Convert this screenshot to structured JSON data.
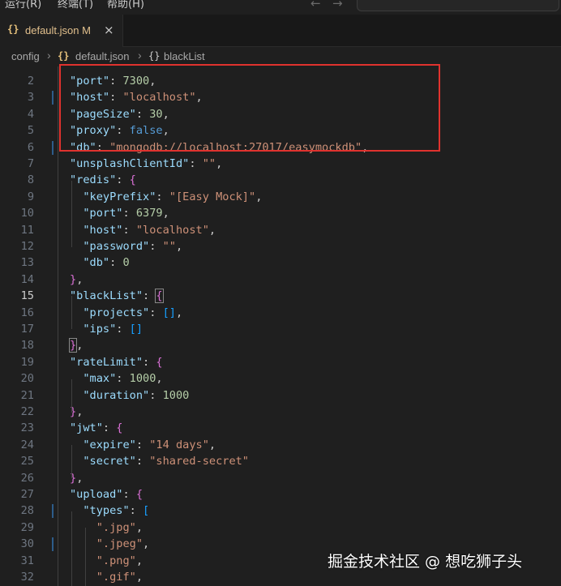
{
  "menubar": {
    "items": [
      "运行(R)",
      "终端(T)",
      "帮助(H)"
    ]
  },
  "tab": {
    "filename": "default.json",
    "modified": "M"
  },
  "breadcrumb": {
    "items": [
      "config",
      "default.json",
      "blackList"
    ]
  },
  "editor": {
    "lines": [
      {
        "n": "2",
        "html": "<span class='k'>\"port\"</span>: <span class='n'>7300</span>,"
      },
      {
        "n": "3",
        "html": "<span class='k'>\"host\"</span>: <span class='s'>\"localhost\"</span>,"
      },
      {
        "n": "4",
        "html": "<span class='k'>\"pageSize\"</span>: <span class='n'>30</span>,"
      },
      {
        "n": "5",
        "html": "<span class='k'>\"proxy\"</span>: <span class='b'>false</span>,"
      },
      {
        "n": "6",
        "html": "<span class='k'>\"db\"</span>: <span class='s'>\"mongodb://localhost:27017/easymockdb\"</span>,"
      },
      {
        "n": "7",
        "html": "<span class='k'>\"unsplashClientId\"</span>: <span class='s'>\"\"</span>,"
      },
      {
        "n": "8",
        "html": "<span class='k'>\"redis\"</span>: <span class='br1'>{</span>"
      },
      {
        "n": "9",
        "html": "  <span class='k'>\"keyPrefix\"</span>: <span class='s'>\"[Easy Mock]\"</span>,"
      },
      {
        "n": "10",
        "html": "  <span class='k'>\"port\"</span>: <span class='n'>6379</span>,"
      },
      {
        "n": "11",
        "html": "  <span class='k'>\"host\"</span>: <span class='s'>\"localhost\"</span>,"
      },
      {
        "n": "12",
        "html": "  <span class='k'>\"password\"</span>: <span class='s'>\"\"</span>,"
      },
      {
        "n": "13",
        "html": "  <span class='k'>\"db\"</span>: <span class='n'>0</span>"
      },
      {
        "n": "14",
        "html": "<span class='br1'>}</span>,"
      },
      {
        "n": "15",
        "html": "<span class='k'>\"blackList\"</span>: <span class='br1 brmatch'>{</span>"
      },
      {
        "n": "16",
        "html": "  <span class='k'>\"projects\"</span>: <span class='br2'>[]</span>,"
      },
      {
        "n": "17",
        "html": "  <span class='k'>\"ips\"</span>: <span class='br2'>[]</span>"
      },
      {
        "n": "18",
        "html": "<span class='br1 brmatch'>}</span>,"
      },
      {
        "n": "19",
        "html": "<span class='k'>\"rateLimit\"</span>: <span class='br1'>{</span>"
      },
      {
        "n": "20",
        "html": "  <span class='k'>\"max\"</span>: <span class='n'>1000</span>,"
      },
      {
        "n": "21",
        "html": "  <span class='k'>\"duration\"</span>: <span class='n'>1000</span>"
      },
      {
        "n": "22",
        "html": "<span class='br1'>}</span>,"
      },
      {
        "n": "23",
        "html": "<span class='k'>\"jwt\"</span>: <span class='br1'>{</span>"
      },
      {
        "n": "24",
        "html": "  <span class='k'>\"expire\"</span>: <span class='s'>\"14 days\"</span>,"
      },
      {
        "n": "25",
        "html": "  <span class='k'>\"secret\"</span>: <span class='s'>\"shared-secret\"</span>"
      },
      {
        "n": "26",
        "html": "<span class='br1'>}</span>,"
      },
      {
        "n": "27",
        "html": "<span class='k'>\"upload\"</span>: <span class='br1'>{</span>"
      },
      {
        "n": "28",
        "html": "  <span class='k'>\"types\"</span>: <span class='br2'>[</span>"
      },
      {
        "n": "29",
        "html": "    <span class='s'>\".jpg\"</span>,"
      },
      {
        "n": "30",
        "html": "    <span class='s'>\".jpeg\"</span>,"
      },
      {
        "n": "31",
        "html": "    <span class='s'>\".png\"</span>,"
      },
      {
        "n": "32",
        "html": "    <span class='s'>\".gif\"</span>,"
      }
    ],
    "active_line": "15",
    "modified_lines": [
      "3",
      "6",
      "28",
      "30"
    ]
  },
  "watermark": "掘金技术社区 @ 想吃狮子头"
}
